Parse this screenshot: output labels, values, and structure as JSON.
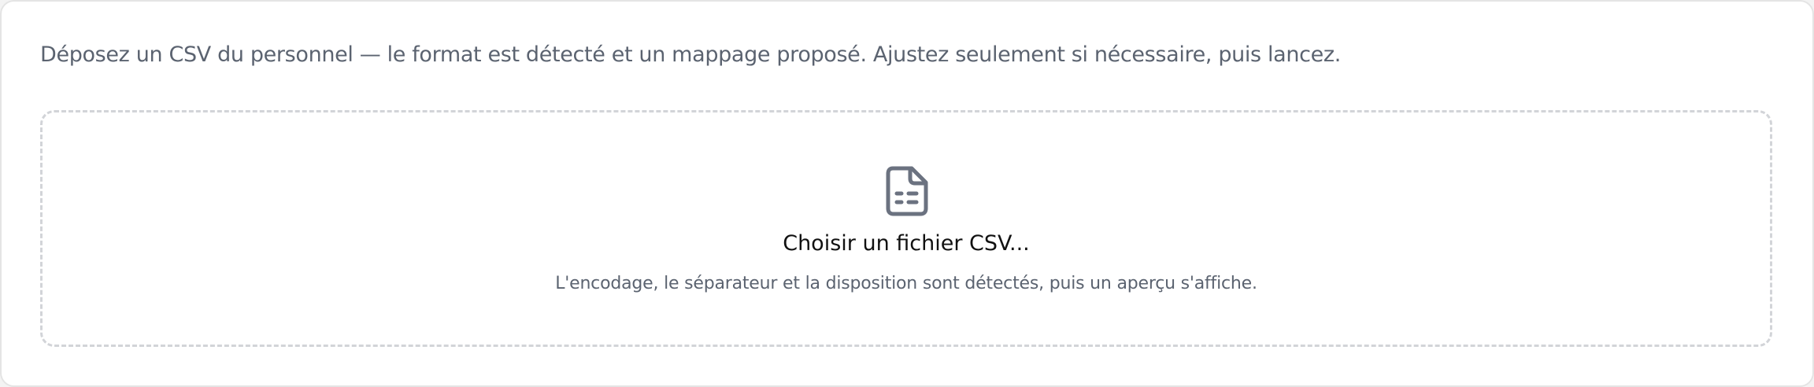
{
  "intro_text": "Déposez un CSV du personnel — le format est détecté et un mappage proposé. Ajustez seulement si nécessaire, puis lancez.",
  "dropzone": {
    "icon": "file-spreadsheet-icon",
    "title": "Choisir un fichier CSV...",
    "hint": "L'encodage, le séparateur et la disposition sont détectés, puis un aperçu s'affiche."
  },
  "colors": {
    "muted_text": "#5b6370",
    "title_text": "#111111",
    "dash_border": "#d2d4d8",
    "icon_stroke": "#6b7280"
  }
}
